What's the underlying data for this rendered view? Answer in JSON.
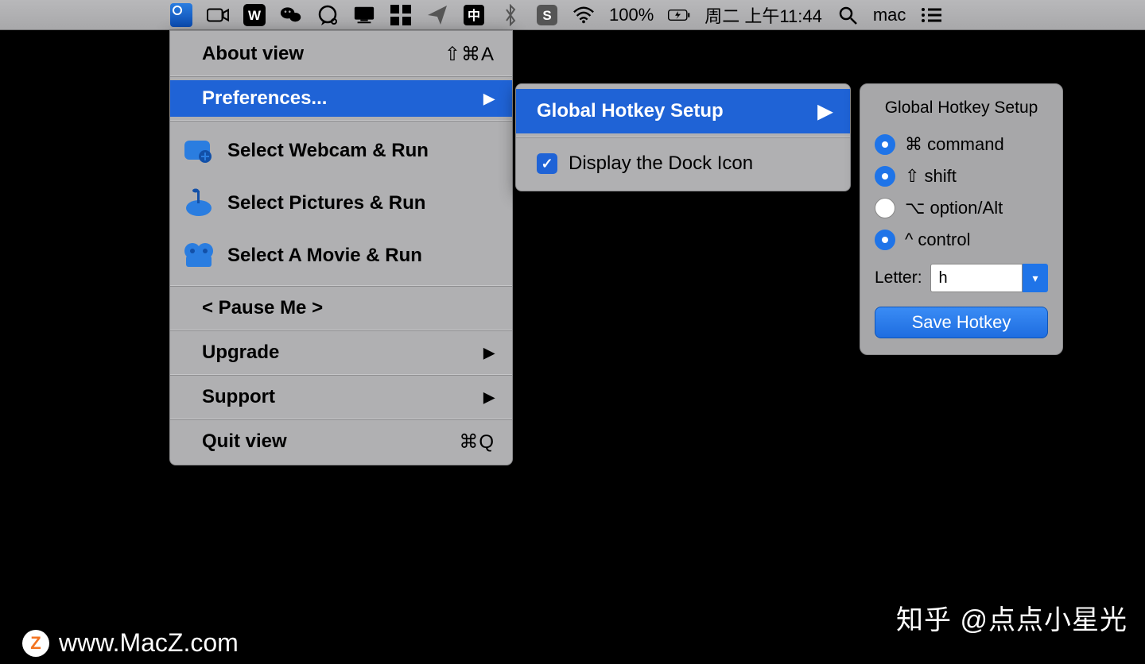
{
  "menubar": {
    "battery": "100%",
    "datetime": "周二 上午11:44",
    "user": "mac"
  },
  "menu": {
    "about": {
      "label": "About view",
      "shortcut": "⇧⌘A"
    },
    "preferences": {
      "label": "Preferences..."
    },
    "select_webcam": {
      "label": "Select Webcam & Run"
    },
    "select_pictures": {
      "label": "Select Pictures & Run"
    },
    "select_movie": {
      "label": "Select A Movie & Run"
    },
    "pause": {
      "label": "< Pause Me >"
    },
    "upgrade": {
      "label": "Upgrade"
    },
    "support": {
      "label": "Support"
    },
    "quit": {
      "label": "Quit view",
      "shortcut": "⌘Q"
    }
  },
  "submenu": {
    "global_hotkey": {
      "label": "Global Hotkey Setup"
    },
    "dock_icon": {
      "label": "Display the Dock Icon",
      "checked": true
    }
  },
  "panel": {
    "title": "Global Hotkey Setup",
    "command": {
      "label": "⌘ command",
      "on": true
    },
    "shift": {
      "label": "⇧ shift",
      "on": true
    },
    "option": {
      "label": "⌥ option/Alt",
      "on": false
    },
    "control": {
      "label": "^ control",
      "on": true
    },
    "letter_label": "Letter:",
    "letter_value": "h",
    "save": "Save Hotkey"
  },
  "watermark": {
    "left": "www.MacZ.com",
    "right": "知乎 @点点小星光"
  }
}
